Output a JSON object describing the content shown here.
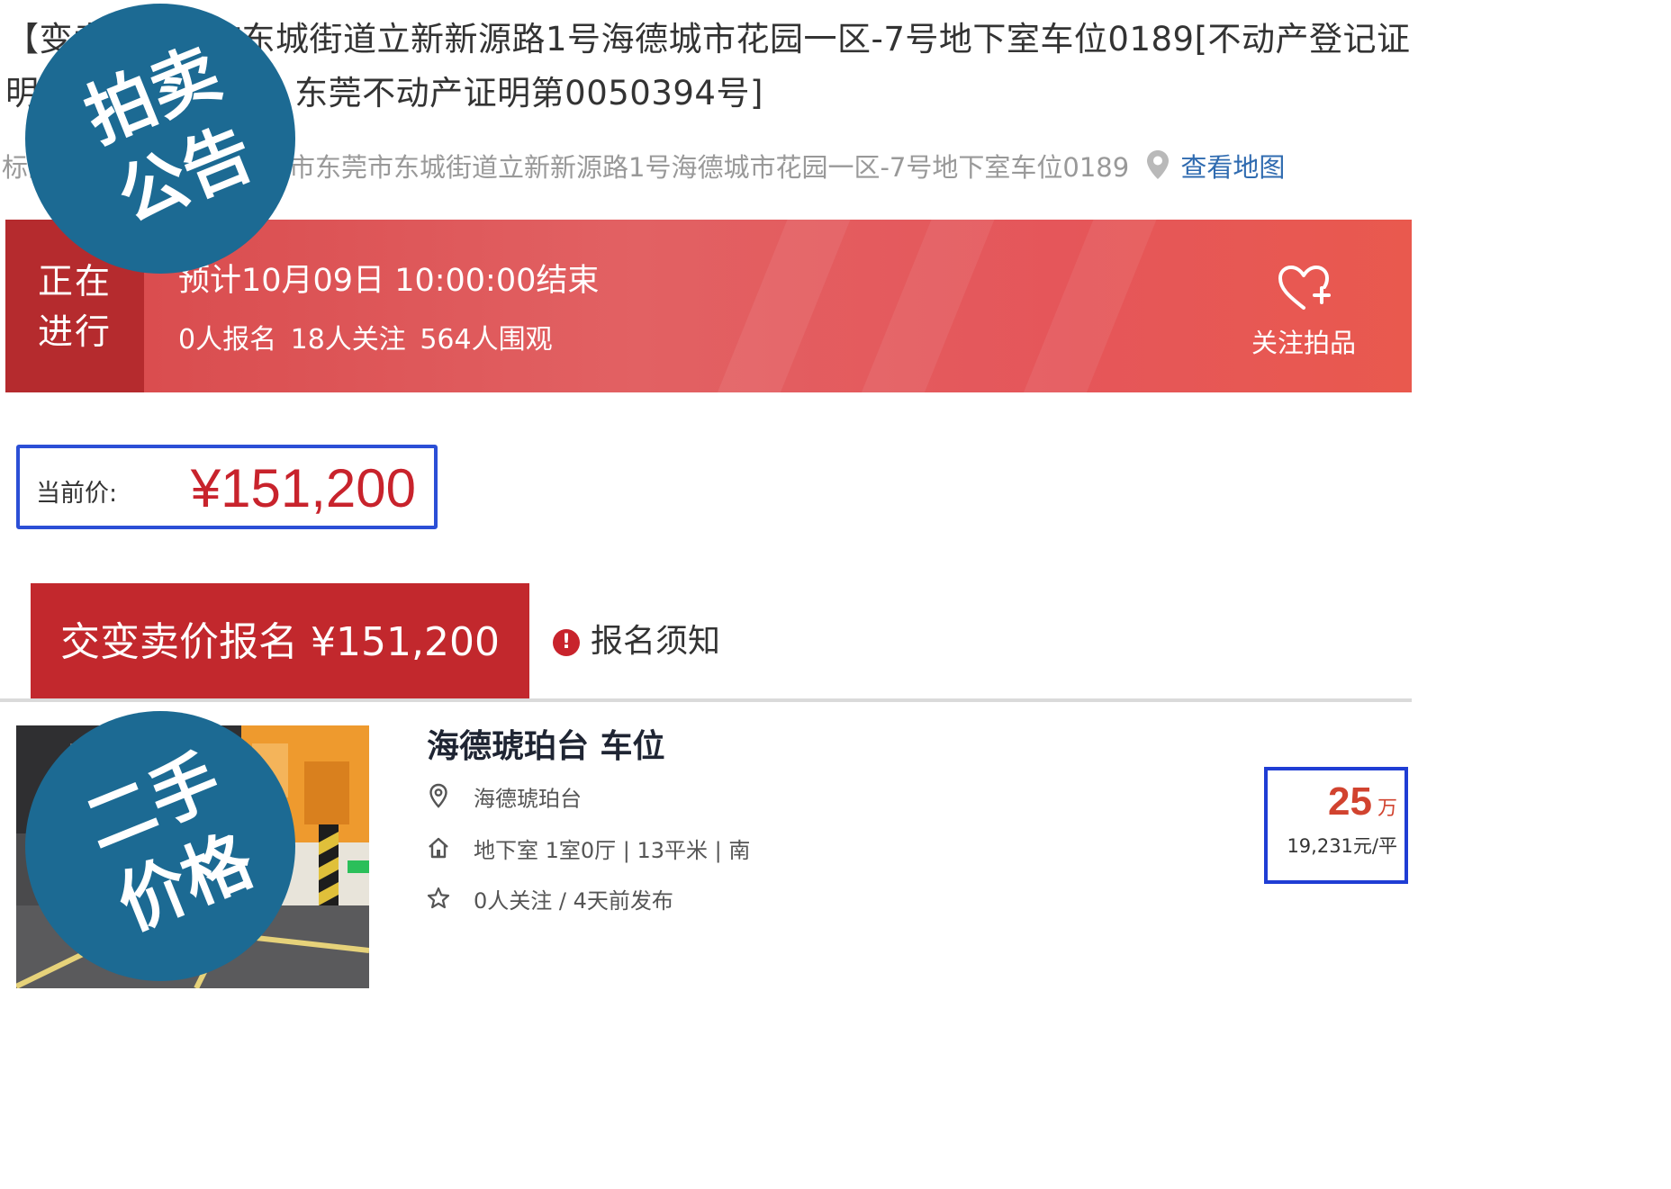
{
  "auction": {
    "title": "【变卖】东莞市东城街道立新新源路1号海德城市花园一区-7号地下室车位0189[不动产登记证明号：粤（2022）东莞不动产证明第0050394号]",
    "address_label": "标的物地址：",
    "address": "广东省东莞市东莞市东城街道立新新源路1号海德城市花园一区-7号地下室车位0189",
    "map_link": "查看地图",
    "status_line1": "正在",
    "status_line2": "进行",
    "end_time": "预计10月09日 10:00:00结束",
    "stats": "0人报名 18人关注 564人围观",
    "favorite_label": "关注拍品",
    "current_price_label": "当前价:",
    "current_price": "¥151,200",
    "signup_button": "交变卖价报名 ¥151,200",
    "notice_link": "报名须知"
  },
  "badges": {
    "auction": [
      "拍卖",
      "公告"
    ],
    "secondhand": [
      "二手",
      "价格"
    ]
  },
  "listing": {
    "title": "海德琥珀台 车位",
    "community": "海德琥珀台",
    "details": "地下室 1室0厅 | 13平米 | 南",
    "meta": "0人关注 / 4天前发布",
    "price": "25",
    "price_unit": "万",
    "unit_price": "19,231元/平"
  },
  "colors": {
    "banner_red": "#E26163",
    "status_dark_red": "#B52B2E",
    "price_red": "#C8232C",
    "badge_blue": "#1C6A93",
    "highlight_border_blue": "#2B4FD6",
    "link_blue": "#2F6BB0"
  },
  "icons": {
    "address": "location-pin-icon",
    "favorite": "heart-plus-icon",
    "notice": "exclamation-circle-icon",
    "community": "map-pin-icon",
    "details": "house-icon",
    "meta": "star-icon"
  }
}
